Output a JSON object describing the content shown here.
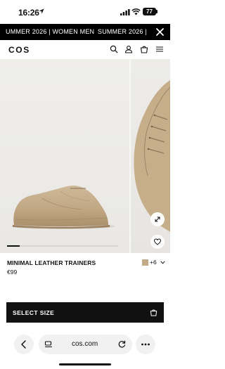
{
  "status_bar": {
    "time": "16:26",
    "battery": "77"
  },
  "promo": {
    "segment_1": "UMMER 2026 | WOMEN MEN",
    "segment_2": "SUMMER 2026 | WO"
  },
  "header": {
    "logo": "COS",
    "icons": [
      "search-icon",
      "account-icon",
      "bag-icon",
      "menu-icon"
    ]
  },
  "product": {
    "name": "MINIMAL LEATHER TRAINERS",
    "price": "€99",
    "colour_swatch": "#c2aa88",
    "more_colours": "+6"
  },
  "cta": {
    "select_size_label": "SELECT SIZE"
  },
  "browser": {
    "url": "cos.com"
  },
  "colors": {
    "accent": "#111111",
    "promo_bg": "#000000",
    "background": "#ffffff",
    "shoe_suede": "#c2aa88"
  }
}
